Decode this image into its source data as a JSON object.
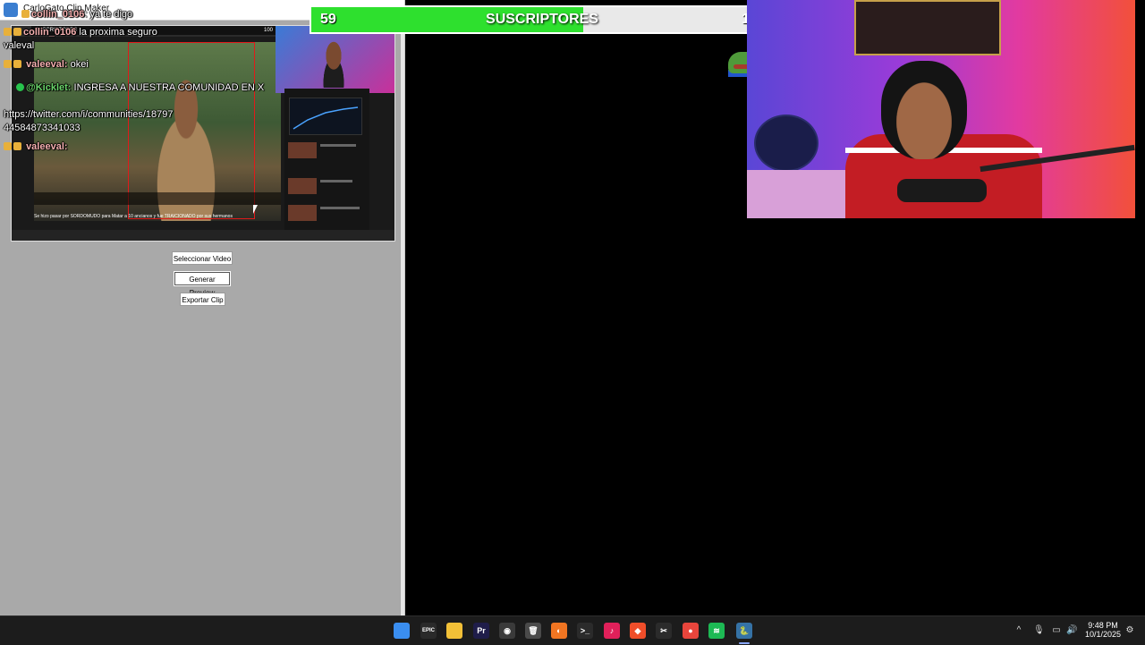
{
  "window": {
    "title": "CarloGato Clip Maker"
  },
  "buttons": {
    "select_video": "Seleccionar Video",
    "generate_preview": "Generar Preview",
    "export_clip": "Exportar Clip"
  },
  "preview": {
    "inner_bar_text": "SUSCRIPTORES",
    "inner_bar_count": "100",
    "caption": "Se hizo pasar por SORDOMUDO para Matar a 10 ancianos y fue TRAICIONADO por sus hermanos"
  },
  "chat": {
    "messages": [
      {
        "user": "collin_0106",
        "text": ": ya te digo"
      },
      {
        "user": "collin_0106",
        "text": "la proxima seguro"
      },
      {
        "user": "",
        "text": "valeval"
      },
      {
        "user": "valeeval:",
        "text": "okei"
      },
      {
        "user": "@Kicklet:",
        "text": "INGRESA A NUESTRA COMUNIDAD EN X"
      },
      {
        "user": "",
        "text": "https://twitter.com/i/communities/18797"
      },
      {
        "user": "",
        "text": "44584873341033"
      },
      {
        "user": "valeeval:",
        "text": ""
      }
    ]
  },
  "subscribers": {
    "current": "59",
    "goal": "100",
    "label": "SUSCRIPTORES",
    "progress": 0.59,
    "fill_color": "#2ee02e"
  },
  "taskbar": {
    "icons": [
      {
        "name": "windows-start-icon",
        "color": "#3a8ef0",
        "glyph": ""
      },
      {
        "name": "epic-games-icon",
        "color": "#2a2a2a",
        "glyph": "EPIC"
      },
      {
        "name": "file-explorer-icon",
        "color": "#f2c037",
        "glyph": ""
      },
      {
        "name": "premiere-pro-icon",
        "color": "#1f1d4a",
        "glyph": "Pr"
      },
      {
        "name": "obs-icon",
        "color": "#3a3a3a",
        "glyph": "◉"
      },
      {
        "name": "trash-icon",
        "color": "#4a4a4a",
        "glyph": "🗑"
      },
      {
        "name": "firefox-icon",
        "color": "#f07522",
        "glyph": "◐"
      },
      {
        "name": "terminal-icon",
        "color": "#2b2b2b",
        "glyph": ">_"
      },
      {
        "name": "tiktok-icon",
        "color": "#e0205a",
        "glyph": "♪"
      },
      {
        "name": "brave-icon",
        "color": "#f04e2a",
        "glyph": "◆"
      },
      {
        "name": "capcut-icon",
        "color": "#2b2b2b",
        "glyph": "✂"
      },
      {
        "name": "chrome-icon",
        "color": "#e8453c",
        "glyph": "●"
      },
      {
        "name": "spotify-icon",
        "color": "#1db954",
        "glyph": "≋"
      },
      {
        "name": "python-app-icon",
        "color": "#3572a5",
        "glyph": "🐍"
      }
    ],
    "clock_time": "9:48 PM",
    "clock_date": "10/1/2025"
  }
}
